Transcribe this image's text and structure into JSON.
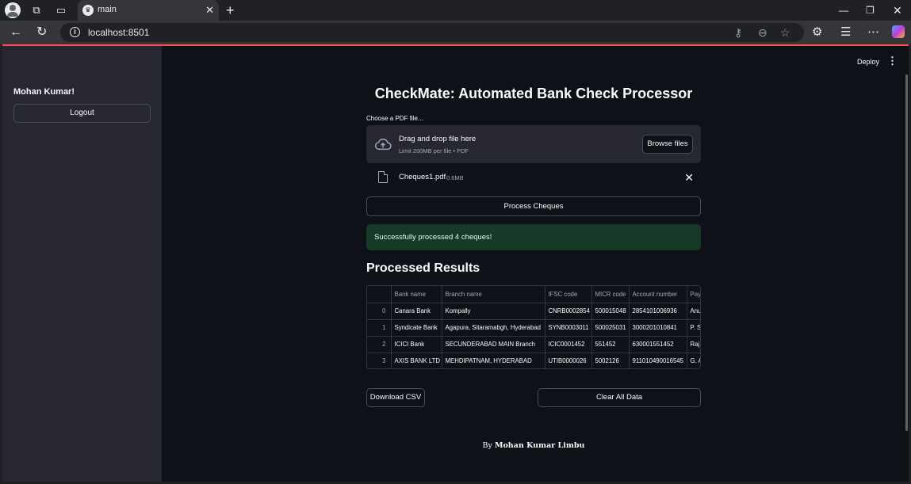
{
  "browser": {
    "tab_title": "main",
    "tab_favicon": "streamlit-crown-icon",
    "url": "localhost:8501"
  },
  "sidebar": {
    "username": "Mohan Kumar!",
    "logout_label": "Logout"
  },
  "header": {
    "deploy_label": "Deploy",
    "menu_icon": "kebab-menu-icon"
  },
  "main": {
    "title": "CheckMate: Automated Bank Check Processor",
    "upload_label": "Choose a PDF file...",
    "dropzone_title": "Drag and drop file here",
    "dropzone_subtitle": "Limit 200MB per file • PDF",
    "browse_label": "Browse files",
    "file": {
      "name": "Cheques1.pdf",
      "size": "0.6MB"
    },
    "process_label": "Process Cheques",
    "success_message": "Successfully processed 4 cheques!",
    "results_title": "Processed Results",
    "table": {
      "columns": [
        "",
        "Bank name",
        "Branch name",
        "IFSC code",
        "MICR code",
        "Account number",
        "Pay"
      ],
      "rows": [
        [
          "0",
          "Canara Bank",
          "Kompally",
          "CNRB0002854",
          "500015048",
          "2854101006936",
          "Anu"
        ],
        [
          "1",
          "Syndicate Bank",
          "Agapura, Sitaramabgh, Hyderabad",
          "SYNB0003011",
          "500025031",
          "3000201010841",
          "P. S"
        ],
        [
          "2",
          "ICICI Bank",
          "SECUNDERABAD MAIN Branch",
          "ICIC0001452",
          "551452",
          "630001551452",
          "Raj"
        ],
        [
          "3",
          "AXIS BANK LTD",
          "MEHDIPATNAM, HYDERABAD",
          "UTIB0000026",
          "5002126",
          "911010490016545",
          "G. A"
        ]
      ]
    },
    "download_label": "Download CSV",
    "clear_label": "Clear All Data",
    "footer_prefix": "By",
    "footer_name": "Mohan Kumar Limbu"
  },
  "colors": {
    "app_background": "#0e1117",
    "sidebar_background": "#262730",
    "success_background": "#173928",
    "accent": "#ff4b4b"
  }
}
